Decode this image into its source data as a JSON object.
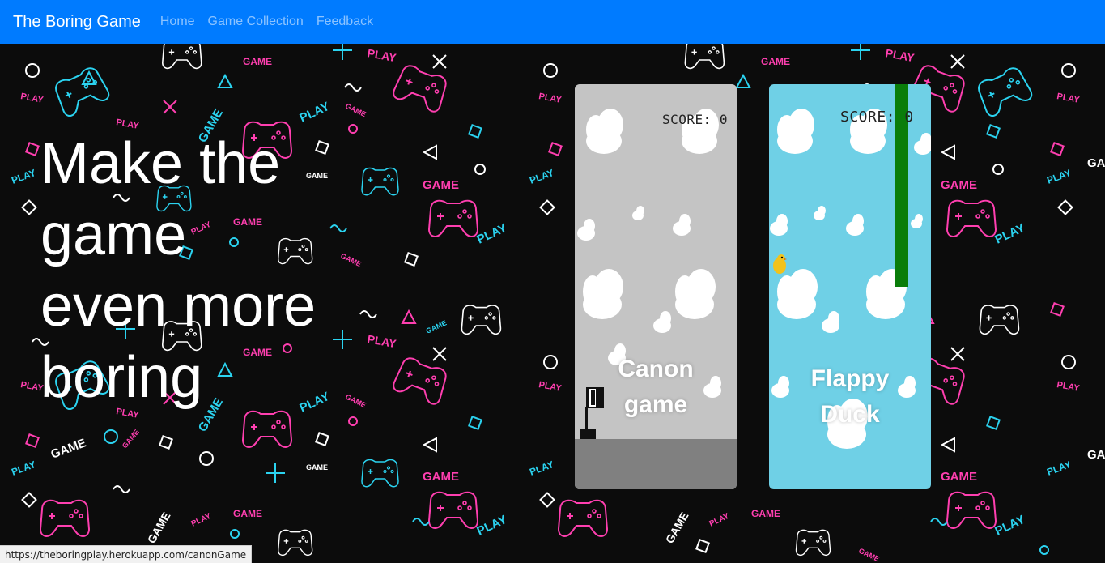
{
  "navbar": {
    "brand": "The Boring Game",
    "links": [
      "Home",
      "Game Collection",
      "Feedback"
    ]
  },
  "hero": {
    "line1": "Make the",
    "line2": "game",
    "line3": "even more",
    "line4": "boring"
  },
  "games": [
    {
      "title_line1": "Canon",
      "title_line2": "game",
      "score": "SCORE: 0"
    },
    {
      "title_line1": "Flappy",
      "title_line2": "Duck",
      "score": "SCORE: 0"
    }
  ],
  "status_bar": {
    "url": "https://theboringplay.herokuapp.com/canonGame"
  },
  "colors": {
    "navbar": "#007bff",
    "pink": "#ff3fb0",
    "cyan": "#2bd3f0",
    "background": "#0c0c0c"
  }
}
